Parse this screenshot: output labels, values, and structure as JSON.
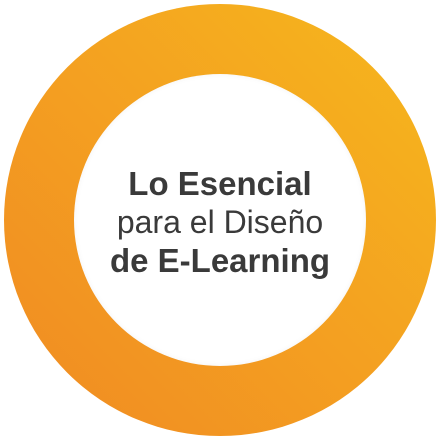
{
  "badge": {
    "title_line1": "Lo Esencial",
    "title_line2": "para el Diseño",
    "title_line3": "de E-Learning",
    "ring_color_start": "#f08a22",
    "ring_color_end": "#f6b81c",
    "text_color": "#3a3a3a"
  }
}
